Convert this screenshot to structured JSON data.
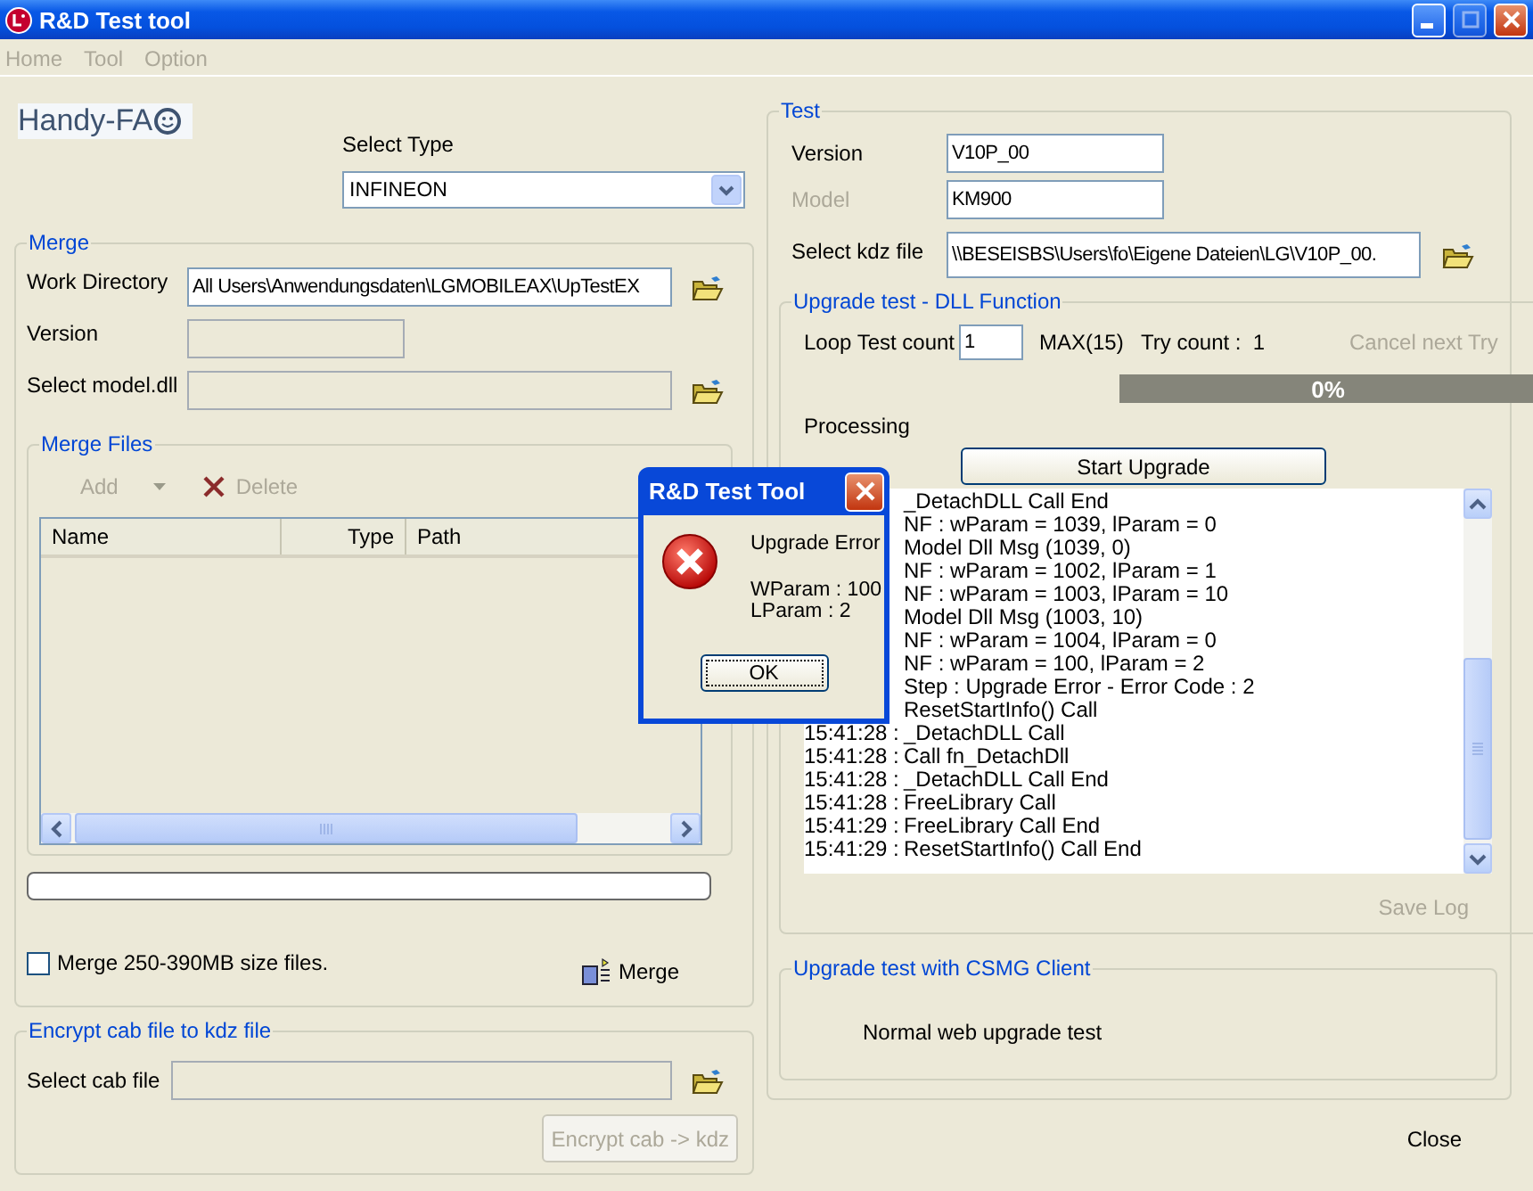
{
  "window": {
    "title": "R&D Test tool"
  },
  "menu": [
    {
      "label": "Home",
      "disabled": true
    },
    {
      "label": "Tool",
      "disabled": true
    },
    {
      "label": "Option",
      "disabled": true
    }
  ],
  "logo": {
    "text": "Handy-FA"
  },
  "select_type": {
    "label": "Select Type",
    "value": "INFINEON"
  },
  "merge": {
    "title": "Merge",
    "fields": [
      {
        "label": "Work Directory",
        "value": "All Users\\Anwendungsdaten\\LGMOBILEAX\\UpTestEX",
        "disabled": false,
        "browse": true,
        "kind": "wide"
      },
      {
        "label": "Version",
        "disabled": true,
        "browse": false,
        "kind": "short"
      },
      {
        "label": "Select model.dll",
        "disabled": true,
        "browse": true,
        "kind": "wide"
      }
    ],
    "merge_files": {
      "title": "Merge Files",
      "toolbar": [
        {
          "label": "Add",
          "disabled": true,
          "kind": "dropdown"
        },
        {
          "label": "Delete",
          "disabled": true,
          "kind": "delete"
        }
      ],
      "columns": [
        "Name",
        "Type",
        "Path"
      ]
    },
    "progress": {
      "level": 0
    },
    "option": {
      "label": "Merge 250-390MB size files.",
      "checked": false
    },
    "button": {
      "label": "Merge"
    }
  },
  "encrypt": {
    "title": "Encrypt cab file to kdz file",
    "field": {
      "label": "Select cab file",
      "disabled": true
    },
    "button": {
      "label": "Encrypt cab -> kdz",
      "disabled": true
    }
  },
  "test": {
    "title": "Test",
    "fields": [
      {
        "label": "Version",
        "value": "V10P_00",
        "disabled": false,
        "browse": false
      },
      {
        "label": "Model",
        "value": "KM900",
        "disabled": true,
        "browse": false
      },
      {
        "label": "Select kdz file",
        "value": "\\\\BESEISBS\\Users\\fo\\Eigene Dateien\\LG\\V10P_00.",
        "disabled": false,
        "browse": true
      }
    ],
    "dll": {
      "title": "Upgrade test - DLL Function",
      "loop_label": "Loop Test count",
      "loop_value": "1",
      "max": "MAX(15)",
      "try_count": "Try count :  1",
      "cancel": {
        "label": "Cancel next Try",
        "disabled": true
      },
      "progress": {
        "level": 0,
        "reading": "0%"
      },
      "status": "Processing",
      "start": {
        "label": "Start Upgrade"
      },
      "log": [
        {
          "text": "_DetachDLL Call End"
        },
        {
          "text": "NF : wParam = 1039, lParam = 0"
        },
        {
          "text": "Model Dll Msg (1039, 0)"
        },
        {
          "text": "NF : wParam = 1002, lParam = 1"
        },
        {
          "text": "NF : wParam = 1003, lParam = 10"
        },
        {
          "text": "Model Dll Msg (1003, 10)"
        },
        {
          "text": "NF : wParam = 1004, lParam = 0"
        },
        {
          "text": "NF : wParam = 100, lParam = 2"
        },
        {
          "text": "Step : Upgrade Error - Error Code : 2"
        },
        {
          "text": "ResetStartInfo() Call"
        },
        {
          "time": "15:41:28 :",
          "text": "_DetachDLL Call"
        },
        {
          "time": "15:41:28 :",
          "text": "Call fn_DetachDll"
        },
        {
          "time": "15:41:28 :",
          "text": "_DetachDLL Call End"
        },
        {
          "time": "15:41:28 :",
          "text": "FreeLibrary Call"
        },
        {
          "time": "15:41:29 :",
          "text": "FreeLibrary Call End"
        },
        {
          "time": "15:41:29 :",
          "text": "ResetStartInfo() Call End"
        }
      ],
      "save_log": {
        "label": "Save Log",
        "disabled": true
      }
    },
    "csmg": {
      "title": "Upgrade test with CSMG Client",
      "button": {
        "label": "Normal web upgrade test"
      }
    }
  },
  "close": {
    "label": "Close"
  },
  "dialog": {
    "title": "R&D Test Tool",
    "message": "Upgrade Error",
    "details": [
      "WParam : 100",
      "LParam : 2"
    ],
    "ok": "OK"
  }
}
